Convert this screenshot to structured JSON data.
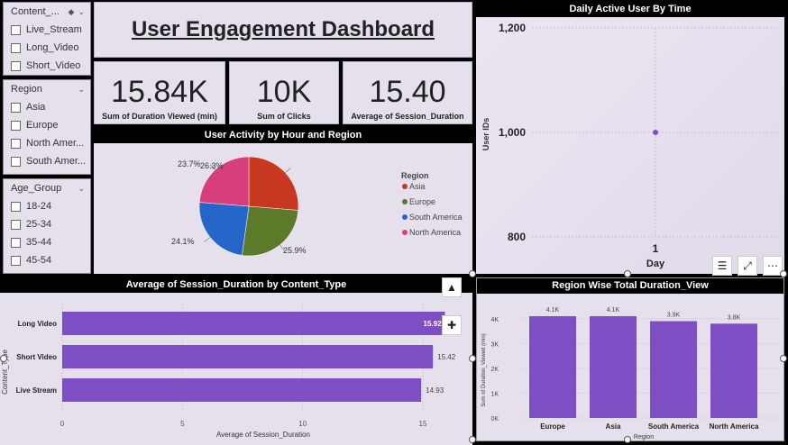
{
  "slicers": {
    "content": {
      "title": "Content_...",
      "items": [
        "Live_Stream",
        "Long_Video",
        "Short_Video"
      ]
    },
    "region": {
      "title": "Region",
      "items": [
        "Asia",
        "Europe",
        "North Amer...",
        "South Amer..."
      ]
    },
    "age": {
      "title": "Age_Group",
      "items": [
        "18-24",
        "25-34",
        "35-44",
        "45-54"
      ]
    }
  },
  "header": {
    "title": "User Engagement Dashboard"
  },
  "kpis": [
    {
      "value": "15.84K",
      "label": "Sum of Duration Viewed (min)"
    },
    {
      "value": "10K",
      "label": "Sum of Clicks"
    },
    {
      "value": "15.40",
      "label": "Average of Session_Duration"
    }
  ],
  "pie": {
    "title": "User Activity by Hour and Region",
    "legend_title": "Region",
    "labels": [
      "26.3%",
      "25.9%",
      "24.1%",
      "23.7%"
    ]
  },
  "line": {
    "title": "Daily Active User By Time",
    "ylabel": "User IDs",
    "xlabel": "Day",
    "yticks": [
      "1,200",
      "1,000",
      "800"
    ],
    "xticks": [
      "1"
    ]
  },
  "hbar": {
    "title": "Average of Session_Duration by Content_Type",
    "ylabel": "Content_Type",
    "xlabel": "Average of Session_Duration",
    "xticks": [
      "0",
      "5",
      "10",
      "15"
    ],
    "value_labels": [
      "15.92",
      "15.42",
      "14.93"
    ]
  },
  "vbar": {
    "title": "Region Wise Total Duration_View",
    "ylabel": "Sum of Duration_Viewed (min)",
    "xlabel": "Region",
    "yticks": [
      "4K",
      "3K",
      "2K",
      "1K",
      "0K"
    ],
    "value_labels": [
      "4.1K",
      "4.1K",
      "3.9K",
      "3.8K"
    ]
  },
  "colors": {
    "asia": "#c8371f",
    "europe": "#5b7a2a",
    "south_america": "#2366c7",
    "north_america": "#d63f7a",
    "bar": "#7e4fc4",
    "panel": "#e6e0ec"
  },
  "chart_data": [
    {
      "type": "pie",
      "title": "User Activity by Hour and Region",
      "categories": [
        "Asia",
        "Europe",
        "South America",
        "North America"
      ],
      "values": [
        26.3,
        25.9,
        24.1,
        23.7
      ],
      "legend": "right"
    },
    {
      "type": "scatter",
      "title": "Daily Active User By Time",
      "xlabel": "Day",
      "ylabel": "User IDs",
      "x": [
        1
      ],
      "y": [
        1000
      ],
      "ylim": [
        800,
        1200
      ]
    },
    {
      "type": "bar",
      "orientation": "horizontal",
      "title": "Average of Session_Duration by Content_Type",
      "categories": [
        "Long Video",
        "Short Video",
        "Live Stream"
      ],
      "values": [
        15.92,
        15.42,
        14.93
      ],
      "xlabel": "Average of Session_Duration",
      "ylabel": "Content_Type",
      "xlim": [
        0,
        16
      ]
    },
    {
      "type": "bar",
      "title": "Region Wise Total Duration_View",
      "categories": [
        "Europe",
        "Asia",
        "South America",
        "North America"
      ],
      "values": [
        4100,
        4100,
        3900,
        3800
      ],
      "xlabel": "Region",
      "ylabel": "Sum of Duration_Viewed (min)",
      "ylim": [
        0,
        4500
      ]
    }
  ]
}
